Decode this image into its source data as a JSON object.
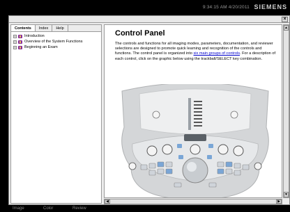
{
  "status": {
    "time": "9:34:15 AM  4/20/2011",
    "brand": "SIEMENS"
  },
  "window": {
    "close_label": "×"
  },
  "nav": {
    "tabs": [
      {
        "label": "Contents"
      },
      {
        "label": "Index"
      },
      {
        "label": "Help"
      }
    ],
    "items": [
      {
        "label": "Introduction",
        "expander": "+"
      },
      {
        "label": "Overview of the System Functions",
        "expander": "+"
      },
      {
        "label": "Beginning an Exam",
        "expander": "+"
      }
    ]
  },
  "content": {
    "title": "Control Panel",
    "paragraph_before_link": "The controls and functions for all imaging modes, parameters, documentation, and reviewer selections are designed to promote quick learning and recognition of the controls and functions. The control panel is organized into ",
    "link_text": "six main groups of controls",
    "paragraph_after_link": ". For a description of each control, click on the graphic below using the trackball/SELECT key combination."
  },
  "scroll": {
    "up": "▲",
    "down": "▼",
    "left": "◀",
    "right": "▶"
  },
  "bottom": {
    "tabs": [
      "Image",
      "Color",
      "Review"
    ]
  }
}
